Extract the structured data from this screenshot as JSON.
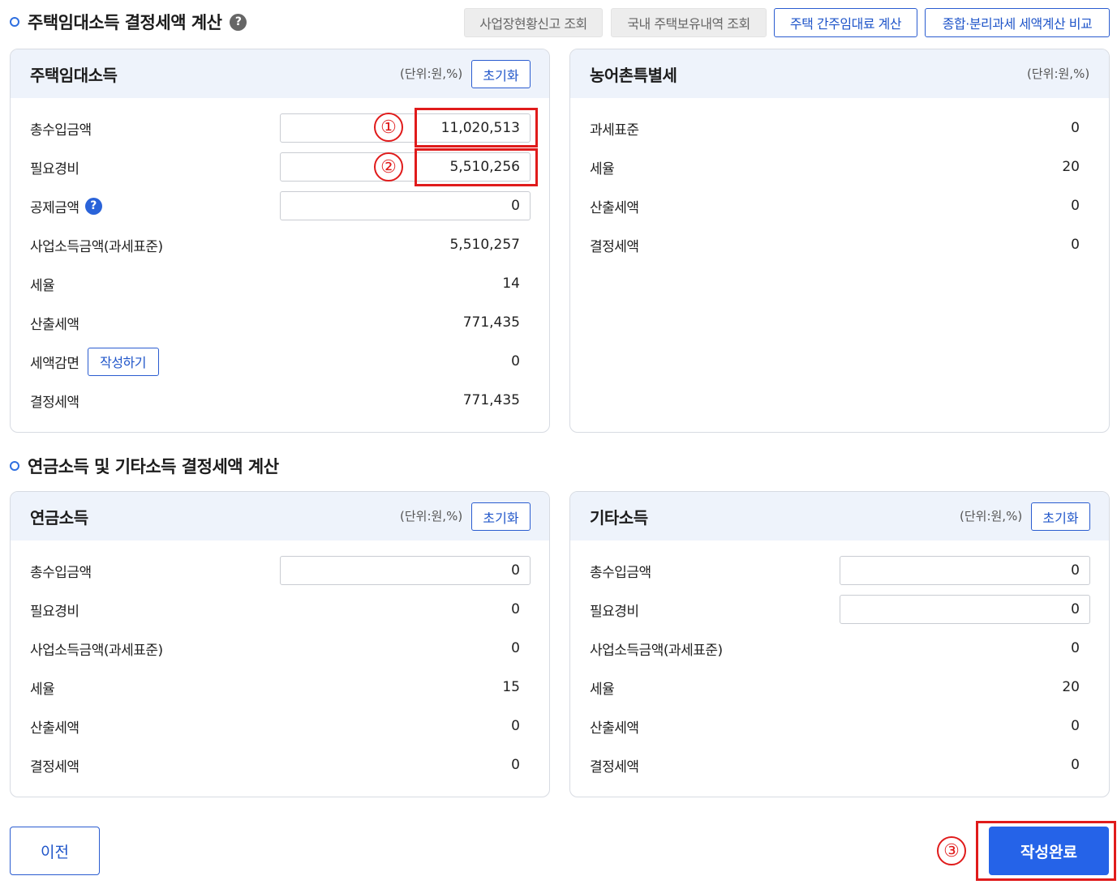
{
  "housing_section": {
    "title": "주택임대소득 결정세액 계산",
    "buttons": {
      "business_report": "사업장현황신고 조회",
      "domestic_housing": "국내 주택보유내역 조회",
      "deemed_rent": "주택 간주임대료 계산",
      "tax_compare": "종합·분리과세 세액계산 비교"
    }
  },
  "housing_income": {
    "title": "주택임대소득",
    "unit": "(단위:원,%)",
    "reset_label": "초기화",
    "rows": {
      "total_income_label": "총수입금액",
      "total_income_value": "11,020,513",
      "expenses_label": "필요경비",
      "expenses_value": "5,510,256",
      "deduction_label": "공제금액",
      "deduction_value": "0",
      "taxable_label": "사업소득금액(과세표준)",
      "taxable_value": "5,510,257",
      "rate_label": "세율",
      "rate_value": "14",
      "calc_tax_label": "산출세액",
      "calc_tax_value": "771,435",
      "reduction_label": "세액감면",
      "reduction_button": "작성하기",
      "reduction_value": "0",
      "final_tax_label": "결정세액",
      "final_tax_value": "771,435"
    }
  },
  "rural_tax": {
    "title": "농어촌특별세",
    "unit": "(단위:원,%)",
    "rows": {
      "base_label": "과세표준",
      "base_value": "0",
      "rate_label": "세율",
      "rate_value": "20",
      "calc_tax_label": "산출세액",
      "calc_tax_value": "0",
      "final_tax_label": "결정세액",
      "final_tax_value": "0"
    }
  },
  "pension_section": {
    "title": "연금소득 및 기타소득 결정세액 계산"
  },
  "pension_income": {
    "title": "연금소득",
    "unit": "(단위:원,%)",
    "reset_label": "초기화",
    "rows": {
      "total_income_label": "총수입금액",
      "total_income_value": "0",
      "expenses_label": "필요경비",
      "expenses_value": "0",
      "taxable_label": "사업소득금액(과세표준)",
      "taxable_value": "0",
      "rate_label": "세율",
      "rate_value": "15",
      "calc_tax_label": "산출세액",
      "calc_tax_value": "0",
      "final_tax_label": "결정세액",
      "final_tax_value": "0"
    }
  },
  "other_income": {
    "title": "기타소득",
    "unit": "(단위:원,%)",
    "reset_label": "초기화",
    "rows": {
      "total_income_label": "총수입금액",
      "total_income_value": "0",
      "expenses_label": "필요경비",
      "expenses_value": "0",
      "taxable_label": "사업소득금액(과세표준)",
      "taxable_value": "0",
      "rate_label": "세율",
      "rate_value": "20",
      "calc_tax_label": "산출세액",
      "calc_tax_value": "0",
      "final_tax_label": "결정세액",
      "final_tax_value": "0"
    }
  },
  "footer": {
    "prev_label": "이전",
    "done_label": "작성완료"
  },
  "annotations": {
    "step1": "①",
    "step2": "②",
    "step3": "③"
  },
  "colors": {
    "accent": "#2563e8",
    "highlight": "#e01b1b",
    "panel_header": "#eef3fb"
  }
}
